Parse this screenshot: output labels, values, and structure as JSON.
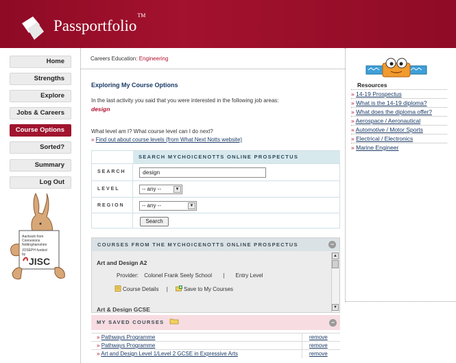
{
  "header": {
    "brand": "Passportfolio",
    "trademark": "TM",
    "bg_color": "#a3122e"
  },
  "nav": {
    "items": [
      {
        "label": "Home",
        "active": false
      },
      {
        "label": "Strengths",
        "active": false
      },
      {
        "label": "Explore",
        "active": false
      },
      {
        "label": "Jobs & Careers",
        "active": false
      },
      {
        "label": "Course Options",
        "active": true
      },
      {
        "label": "Sorted?",
        "active": false
      },
      {
        "label": "Summary",
        "active": false
      },
      {
        "label": "Log Out",
        "active": false
      }
    ]
  },
  "mascot": {
    "lines": [
      "Aardvark from",
      "Connexions",
      "Nottinghamshire",
      "JOSEPH funded",
      "by"
    ],
    "jisc": "JISC"
  },
  "breadcrumb": {
    "prefix": "Careers Education: ",
    "current": "Engineering"
  },
  "main": {
    "title": "Exploring My Course Options",
    "intro": "In the last activity you said that you were interested in the following job areas:",
    "interest": "design",
    "question": "What level am I? What course level can I do next?",
    "levels_link_prefix": "» ",
    "levels_link": "Find out about course levels (from What Next Notts website)"
  },
  "search": {
    "header": "SEARCH MYCHOICENOTTS ONLINE PROSPECTUS",
    "search_label": "SEARCH",
    "search_value": "design",
    "level_label": "LEVEL",
    "level_value": "-- any --",
    "region_label": "REGION",
    "region_value": "-- any --",
    "button": "Search"
  },
  "courses": {
    "header": "COURSES FROM THE MYCHOICENOTTS ONLINE PROSPECTUS",
    "collapse": "−",
    "first_title": "Art and Design A2",
    "provider_label": "Provider:",
    "provider_name": "Colonel Frank Seely School",
    "separator": "|",
    "level": "Entry Level",
    "details": "Course Details",
    "save": "Save to My Courses",
    "next_title": "Art & Design GCSE"
  },
  "saved": {
    "header": "MY SAVED COURSES",
    "collapse": "−",
    "items": [
      {
        "chev": "»",
        "name": "Pathways Programme",
        "remove": "remove"
      },
      {
        "chev": "»",
        "name": "Pathways Programme",
        "remove": "remove"
      },
      {
        "chev": "»",
        "name": "Art and Design Level 1/Level 2 GCSE in Expressive Arts",
        "remove": "remove"
      }
    ]
  },
  "resources": {
    "title": "Resources",
    "items": [
      {
        "chev": "»",
        "label": "14-19 Prospectus"
      },
      {
        "chev": "»",
        "label": "What is the 14-19 diploma?"
      },
      {
        "chev": "»",
        "label": "What does the diploma offer?"
      },
      {
        "chev": "»",
        "label": "Aerospace / Aeronautical"
      },
      {
        "chev": "»",
        "label": "Automotive / Motor Sports"
      },
      {
        "chev": "»",
        "label": "Electrical / Electronics"
      },
      {
        "chev": "»",
        "label": "Marine Engineer"
      }
    ]
  }
}
